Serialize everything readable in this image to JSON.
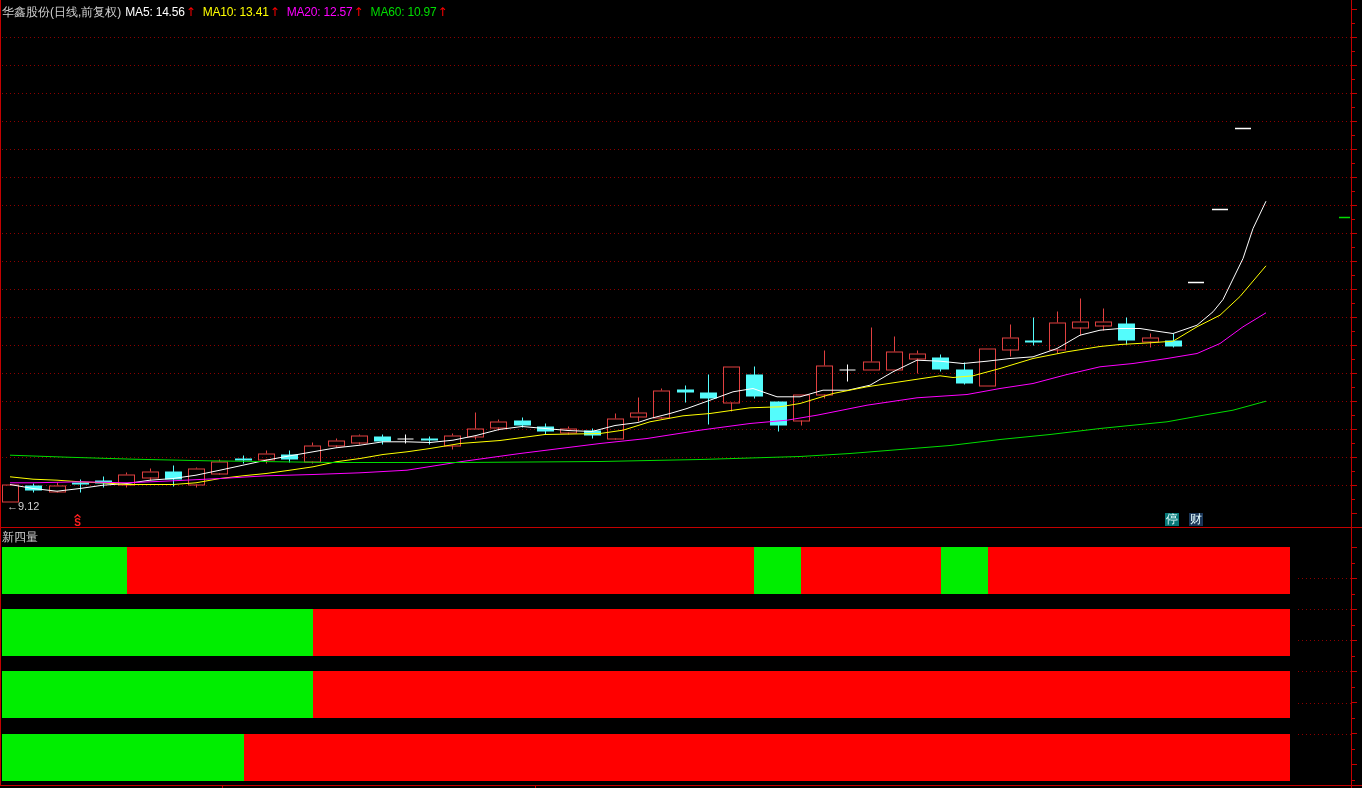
{
  "header": {
    "title": "华鑫股份(日线,前复权)",
    "indicators": [
      {
        "label": "MA5: 14.56",
        "color": "#ffffff",
        "arrow": "↑"
      },
      {
        "label": "MA10: 13.41",
        "color": "#ffff00",
        "arrow": "↑"
      },
      {
        "label": "MA20: 12.57",
        "color": "#ff00ff",
        "arrow": "↑"
      },
      {
        "label": "MA60: 10.97",
        "color": "#00dd00",
        "arrow": "↑"
      }
    ]
  },
  "price_panel": {
    "low_label": "←9.12",
    "signal": "S",
    "badges": [
      {
        "text": "停",
        "color": "#087878"
      },
      {
        "text": "财",
        "color": "#1a3658"
      }
    ]
  },
  "indicator_panel": {
    "title": "新四量"
  }
}
